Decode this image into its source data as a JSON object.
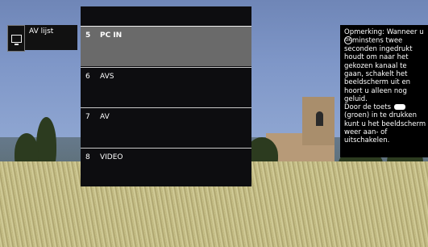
{
  "left_panel": {
    "icon": "tv-icon",
    "title": "AV lijst"
  },
  "menu": {
    "items": [
      {
        "num": "5",
        "label": "PC IN",
        "selected": true
      },
      {
        "num": "6",
        "label": "AVS",
        "selected": false
      },
      {
        "num": "7",
        "label": "AV",
        "selected": false
      },
      {
        "num": "8",
        "label": "VIDEO",
        "selected": false
      }
    ]
  },
  "info": {
    "part1": "Opmerking: Wanneer u",
    "ok_icon": "ok-button-icon",
    "part2": "minstens twee seconden ingedrukt houdt om naar het gekozen kanaal te gaan, schakelt het beeldscherm uit en hoort u alleen nog geluid.",
    "part3": "Door de toets",
    "green_icon": "green-button-icon",
    "part4": "(groen) in te drukken kunt u het beeldscherm weer aan- of uitschakelen."
  },
  "colors": {
    "menu_bg": "#0d0d10",
    "selected_bg": "#6a6a6a",
    "text": "#ffffff"
  }
}
